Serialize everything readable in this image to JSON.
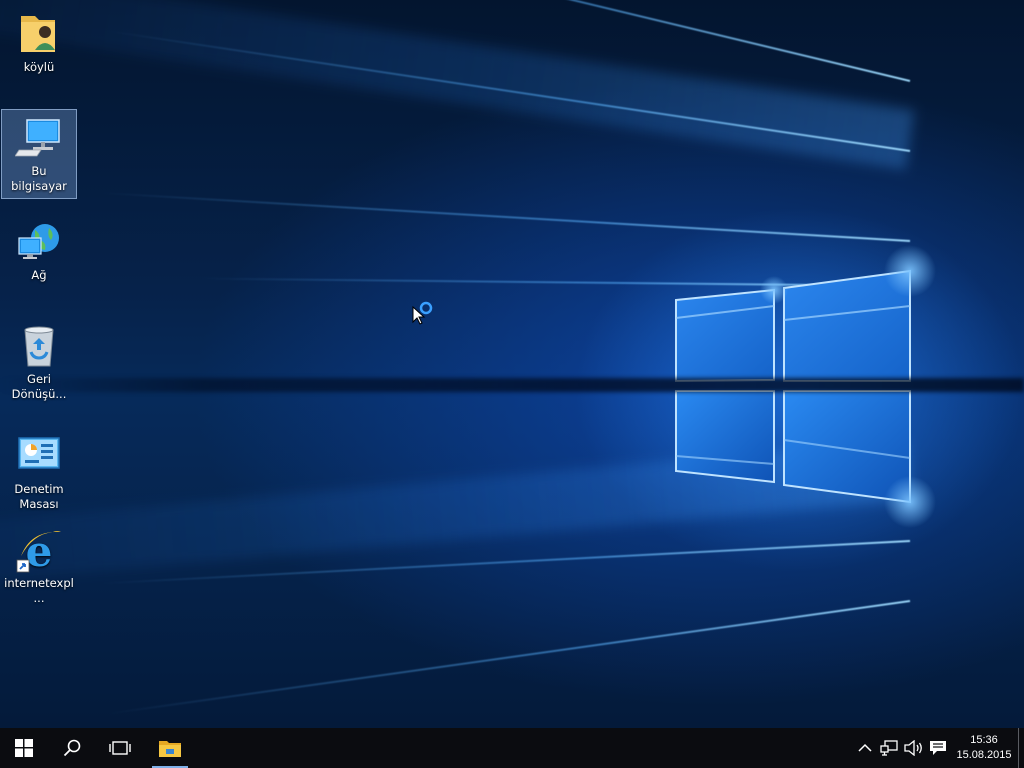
{
  "desktop": {
    "icons": [
      {
        "label": "köylü",
        "icon": "user-folder-icon"
      },
      {
        "label": "Bu bilgisayar",
        "icon": "computer-icon",
        "selected": true
      },
      {
        "label": "Ağ",
        "icon": "network-icon"
      },
      {
        "label": "Geri Dönüşü...",
        "icon": "recycle-bin-icon"
      },
      {
        "label": "Denetim Masası",
        "icon": "control-panel-icon"
      },
      {
        "label": "internetexpl...",
        "icon": "internet-explorer-icon"
      }
    ]
  },
  "taskbar": {
    "buttons": [
      {
        "name": "start",
        "icon": "windows-logo-icon"
      },
      {
        "name": "search",
        "icon": "search-icon"
      },
      {
        "name": "task-view",
        "icon": "task-view-icon"
      },
      {
        "name": "file-explorer",
        "icon": "folder-icon",
        "active": true
      }
    ],
    "tray": {
      "icons": [
        "chevron-up-icon",
        "network-wired-icon",
        "speaker-icon",
        "action-center-icon"
      ]
    },
    "clock": {
      "time": "15:36",
      "date": "15.08.2015"
    }
  },
  "colors": {
    "taskbar_bg": "#0b0c10",
    "accent": "#7fb0e8",
    "logo_light": "#3a9bff"
  }
}
